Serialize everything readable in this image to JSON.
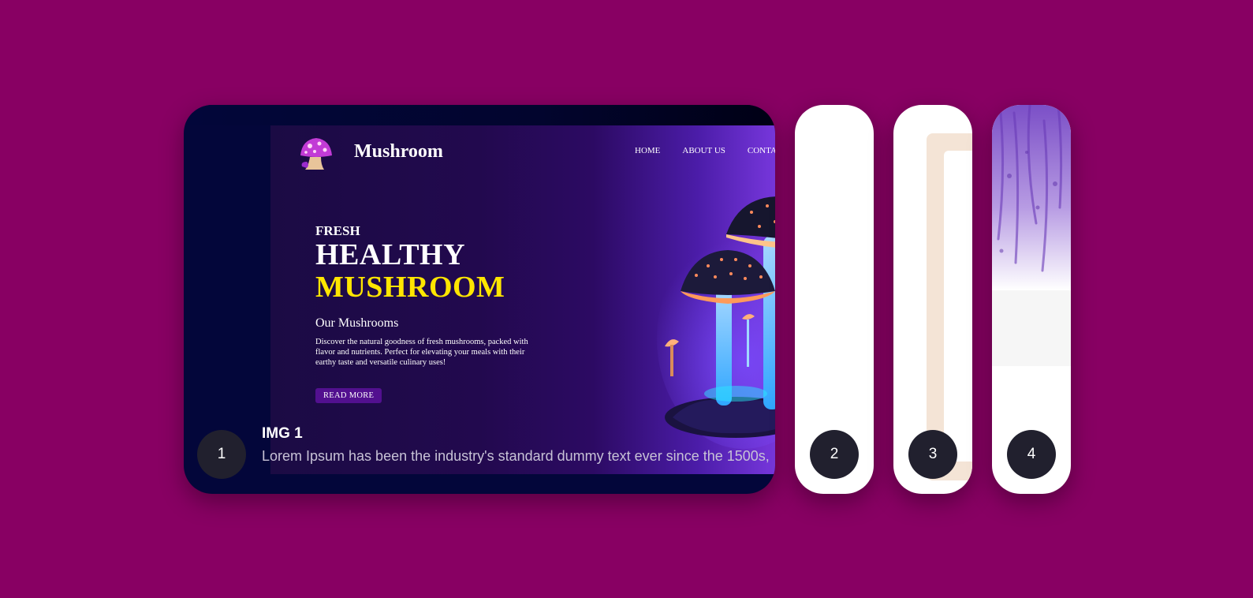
{
  "colors": {
    "background": "#880063",
    "active_card": "#03063a",
    "badge": "#21202e",
    "accent_yellow": "#ffe600",
    "button_purple": "#52108f"
  },
  "slides": [
    {
      "number": "1",
      "title": "IMG 1",
      "description": "Lorem Ipsum has been the industry's standard dummy text ever since the 1500s,",
      "preview": {
        "brand": "Mushroom",
        "logo_icon": "mushroom-icon",
        "nav": [
          "HOME",
          "ABOUT US",
          "CONTA"
        ],
        "hero_small": "FRESH",
        "hero_line1": "HEALTHY",
        "hero_line2": "MUSHROOM",
        "subtitle": "Our Mushrooms",
        "description": "Discover the natural goodness of fresh mushrooms, packed with flavor and nutrients. Perfect for elevating your meals with their earthy taste and versatile culinary uses!",
        "button": "READ MORE"
      }
    },
    {
      "number": "2"
    },
    {
      "number": "3"
    },
    {
      "number": "4"
    }
  ]
}
